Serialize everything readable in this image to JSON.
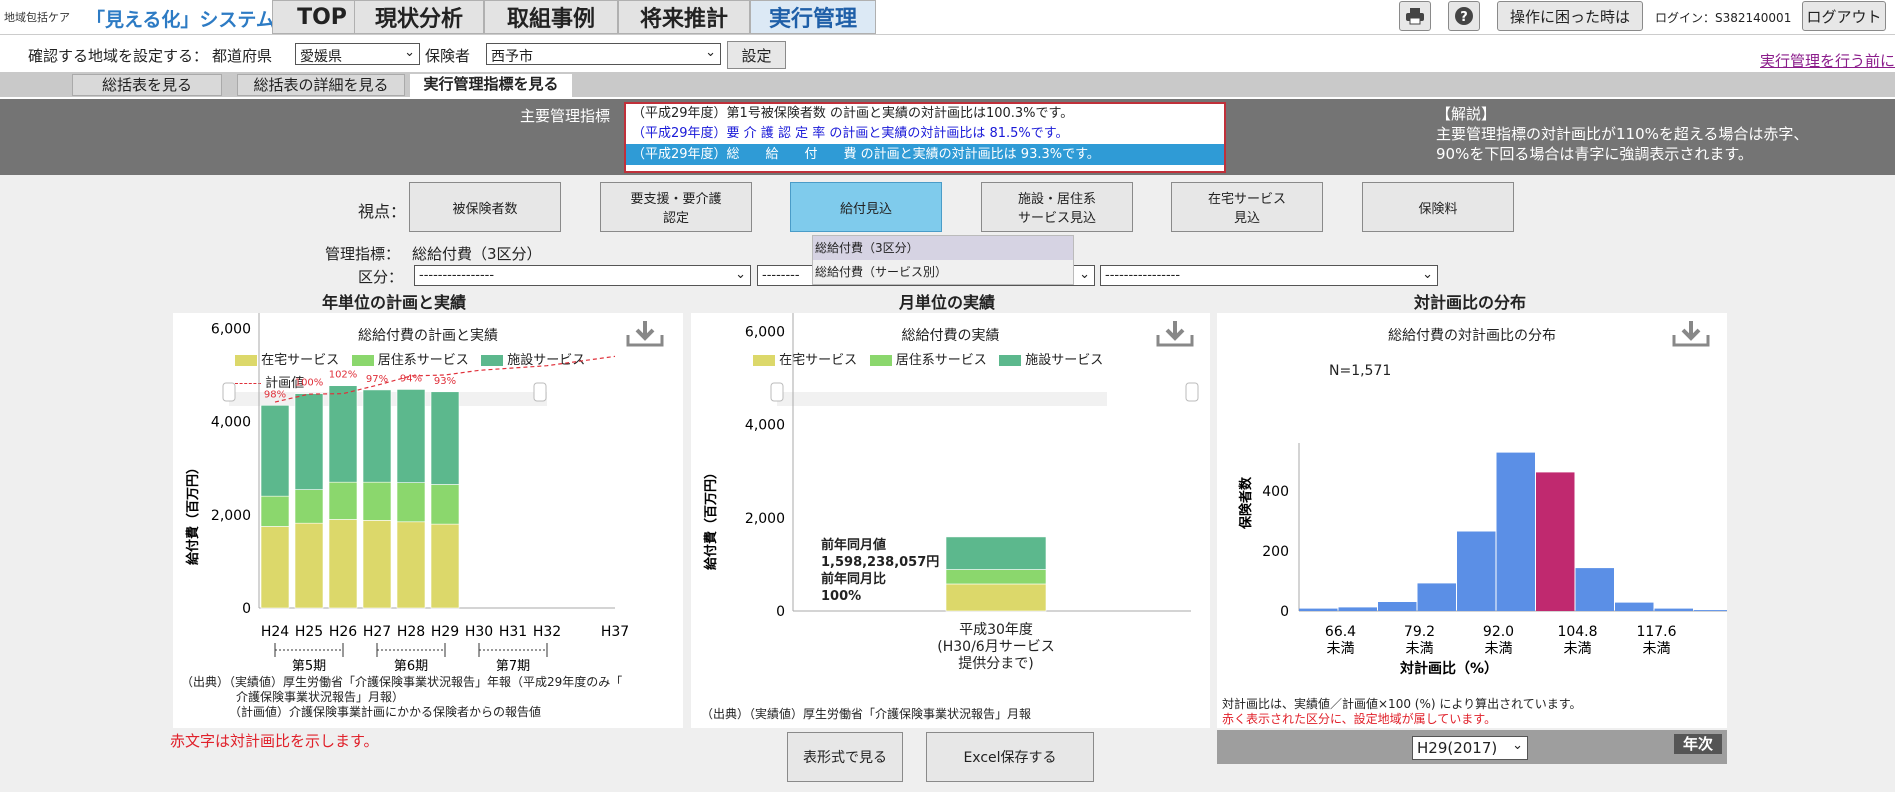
{
  "header": {
    "brand_small": "地域包括ケア",
    "brand": "「見える化」システム",
    "tabs": [
      "TOP",
      "現状分析",
      "取組事例",
      "将来推計",
      "実行管理"
    ],
    "help_button": "操作に困った時は",
    "login": "ログイン：S382140001",
    "logout": "ログアウト"
  },
  "region": {
    "label": "確認する地域を設定する：",
    "pref_label": "都道府県",
    "pref_value": "愛媛県",
    "insurer_label": "保険者",
    "insurer_value": "西予市",
    "set_button": "設定",
    "link": "実行管理を行う前に"
  },
  "subtabs": [
    "総括表を見る",
    "総括表の詳細を見る",
    "実行管理指標を見る"
  ],
  "indicators": {
    "label": "主要管理指標",
    "items": [
      "（平成29年度）第1号被保険者数 の計画と実績の対計画比は100.3%です。",
      "（平成29年度）要 介 護 認 定 率 の計画と実績の対計画比は 81.5%です。",
      "（平成29年度）総　　給　　付　　費 の計画と実績の対計画比は 93.3%です。"
    ],
    "note_title": "【解説】",
    "note_lines": [
      "主要管理指標の対計画比が110%を超える場合は赤字、",
      "90%を下回る場合は青字に強調表示されます。"
    ]
  },
  "viewpoint": {
    "label": "視点：",
    "buttons": [
      "被保険者数",
      "要支援・要介護\n認定",
      "給付見込",
      "施設・居住系\nサービス見込",
      "在宅サービス\n見込",
      "保険料"
    ]
  },
  "metric": {
    "label": "管理指標：",
    "value": "総給付費（3区分）",
    "dropdown": [
      "総給付費（3区分）",
      "総給付費（サービス別）"
    ]
  },
  "category": {
    "label": "区分：",
    "sel1": "----------------",
    "sel2": "--------",
    "sel3": "----------------"
  },
  "sections": [
    "年単位の計画と実績",
    "月単位の実績",
    "対計画比の分布"
  ],
  "chart1": {
    "title": "総給付費の計画と実績",
    "legend": [
      "在宅サービス",
      "居住系サービス",
      "施設サービス",
      "計画値"
    ],
    "ylabel": "給付費（百万円）",
    "yticks": [
      "6,000",
      "4,000",
      "2,000",
      "0"
    ],
    "xticks": [
      "H24",
      "H25",
      "H26",
      "H27",
      "H28",
      "H29",
      "H30",
      "H31",
      "H32",
      "H37"
    ],
    "periods": [
      "第5期",
      "第6期",
      "第7期"
    ],
    "source": [
      "（出典）（実績値）厚生労働省「介護保険事業状況報告」年報（平成29年度のみ「",
      "介護保険事業状況報告」月報）",
      "（計画値）介護保険事業計画にかかる保険者からの報告値"
    ]
  },
  "chart2": {
    "title": "総給付費の実績",
    "legend": [
      "在宅サービス",
      "居住系サービス",
      "施設サービス"
    ],
    "ylabel": "給付費（百万円）",
    "yticks": [
      "6,000",
      "4,000",
      "2,000",
      "0"
    ],
    "annot": [
      "前年同月値",
      "1,598,238,057円",
      "前年同月比",
      "100%"
    ],
    "xlabel": [
      "平成30年度",
      "(H30/6月サービス",
      "提供分まで)"
    ],
    "source": "（出典）（実績値）厚生労働省「介護保険事業状況報告」月報"
  },
  "chart3": {
    "title": "総給付費の対計画比の分布",
    "n": "N=1,571",
    "ylabel": "保険者数",
    "yticks": [
      "400",
      "200",
      "0"
    ],
    "xticks": [
      [
        "66.4",
        "未満"
      ],
      [
        "79.2",
        "未満"
      ],
      [
        "92.0",
        "未満"
      ],
      [
        "104.8",
        "未満"
      ],
      [
        "117.6",
        "未満"
      ]
    ],
    "xlabel": "対計画比（%）",
    "note1": "対計画比は、実績値／計画値×100 (%) により算出されています。",
    "note2": "赤く表示された区分に、設定地域が属しています。",
    "year_select": "H29(2017)",
    "period_badge": "年次"
  },
  "footer_note": "赤文字は対計画比を示します。",
  "buttons": {
    "table": "表形式で見る",
    "excel": "Excel保存する"
  },
  "chart_data": [
    {
      "type": "bar",
      "title": "総給付費の計画と実績",
      "categories": [
        "H24",
        "H25",
        "H26",
        "H27",
        "H28",
        "H29"
      ],
      "series": [
        {
          "name": "在宅サービス",
          "values": [
            1750,
            1820,
            1900,
            1880,
            1850,
            1800
          ]
        },
        {
          "name": "居住系サービス",
          "values": [
            650,
            720,
            800,
            820,
            840,
            850
          ]
        },
        {
          "name": "施設サービス",
          "values": [
            1950,
            2060,
            2070,
            1980,
            2000,
            1990
          ]
        }
      ],
      "plan": {
        "name": "計画値",
        "x": [
          "H24",
          "H25",
          "H26",
          "H27",
          "H28",
          "H29",
          "H30",
          "H31",
          "H32",
          "H37"
        ],
        "values": [
          4420,
          4590,
          4600,
          4780,
          4980,
          5000,
          5100,
          5150,
          5200,
          5400
        ]
      },
      "ratio_labels": [
        "98%",
        "100%",
        "102%",
        "97%",
        "94%",
        "93%"
      ],
      "ylabel": "給付費（百万円）",
      "ylim": [
        0,
        7000
      ]
    },
    {
      "type": "bar",
      "title": "総給付費の実績",
      "categories": [
        "平成30年度"
      ],
      "series": [
        {
          "name": "在宅サービス",
          "values": [
            580
          ]
        },
        {
          "name": "居住系サービス",
          "values": [
            310
          ]
        },
        {
          "name": "施設サービス",
          "values": [
            700
          ]
        }
      ],
      "ylabel": "給付費（百万円）",
      "ylim": [
        0,
        7000
      ]
    },
    {
      "type": "bar",
      "title": "総給付費の対計画比の分布",
      "bins": [
        "<60",
        "60-66.4",
        "66.4-72.8",
        "72.8-79.2",
        "79.2-85.6",
        "85.6-92.0",
        "92.0-98.4",
        "98.4-104.8",
        "104.8-111.2",
        "111.2-117.6",
        "117.6-124.0",
        "124.0-"
      ],
      "values": [
        8,
        12,
        30,
        92,
        265,
        528,
        462,
        143,
        28,
        8,
        3,
        1
      ],
      "highlight_bin": 6,
      "n": "N=1,571",
      "xlabel": "対計画比（%）",
      "ylabel": "保険者数",
      "ylim": [
        0,
        560
      ]
    }
  ],
  "colors": {
    "home": "#dcd86a",
    "residential": "#8bd76d",
    "facility": "#5cb88d",
    "plan": "#e0303a",
    "hist": "#5b8fe6",
    "hist_highlight": "#c0296f",
    "grey_band": "#747474"
  }
}
